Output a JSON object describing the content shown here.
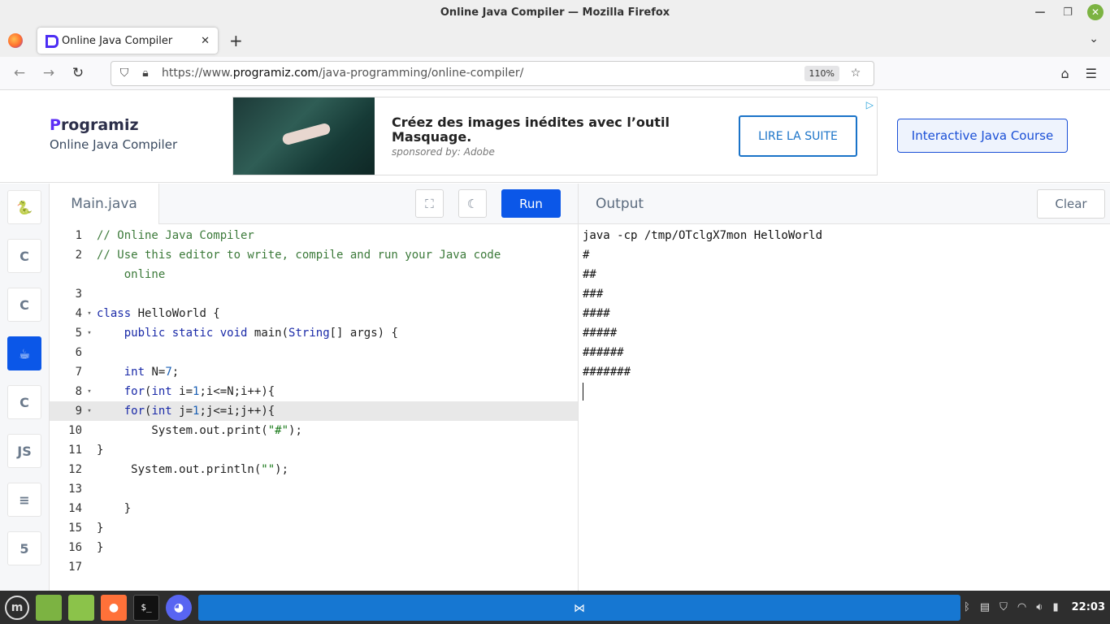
{
  "window": {
    "title": "Online Java Compiler — Mozilla Firefox"
  },
  "tab": {
    "label": "Online Java Compiler",
    "close": "✕",
    "new": "+"
  },
  "nav": {
    "url_prefix": "https://www.",
    "url_domain": "programiz.com",
    "url_path": "/java-programming/online-compiler/",
    "zoom": "110%"
  },
  "header": {
    "brand_p": "P",
    "brand_rest": "rogramiz",
    "subtitle": "Online Java Compiler",
    "course_button": "Interactive Java Course"
  },
  "ad": {
    "headline": "Créez des images inédites avec l’outil Masquage.",
    "sponsor": "sponsored by: Adobe",
    "cta": "LIRE LA SUITE"
  },
  "langbar": {
    "items": [
      {
        "name": "python",
        "glyph": "🐍"
      },
      {
        "name": "c",
        "glyph": "C"
      },
      {
        "name": "cpp",
        "glyph": "C"
      },
      {
        "name": "java",
        "glyph": "☕"
      },
      {
        "name": "csharp",
        "glyph": "C"
      },
      {
        "name": "javascript",
        "glyph": "JS"
      },
      {
        "name": "sql",
        "glyph": "≡"
      },
      {
        "name": "html",
        "glyph": "5"
      }
    ]
  },
  "editor": {
    "filename": "Main.java",
    "run_label": "Run",
    "lines": [
      {
        "n": "1",
        "fold": "",
        "text": "// Online Java Compiler"
      },
      {
        "n": "2",
        "fold": "",
        "text": "// Use this editor to write, compile and run your Java code"
      },
      {
        "n": "",
        "fold": "",
        "text": "    online"
      },
      {
        "n": "3",
        "fold": "",
        "text": ""
      },
      {
        "n": "4",
        "fold": "▾",
        "text": "class HelloWorld {"
      },
      {
        "n": "5",
        "fold": "▾",
        "text": "    public static void main(String[] args) {"
      },
      {
        "n": "6",
        "fold": "",
        "text": ""
      },
      {
        "n": "7",
        "fold": "",
        "text": "    int N=7;"
      },
      {
        "n": "8",
        "fold": "▾",
        "text": "    for(int i=1;i<=N;i++){"
      },
      {
        "n": "9",
        "fold": "▾",
        "text": "    for(int j=1;j<=i;j++){"
      },
      {
        "n": "10",
        "fold": "",
        "text": "        System.out.print(\"#\");"
      },
      {
        "n": "11",
        "fold": "",
        "text": "}"
      },
      {
        "n": "12",
        "fold": "",
        "text": "     System.out.println(\"\");"
      },
      {
        "n": "13",
        "fold": "",
        "text": ""
      },
      {
        "n": "14",
        "fold": "",
        "text": "    }"
      },
      {
        "n": "15",
        "fold": "",
        "text": "}"
      },
      {
        "n": "16",
        "fold": "",
        "text": "}"
      },
      {
        "n": "17",
        "fold": "",
        "text": ""
      }
    ]
  },
  "output": {
    "title": "Output",
    "clear_label": "Clear",
    "lines": [
      "java -cp /tmp/OTclgX7mon HelloWorld",
      "#",
      "##",
      "###",
      "####",
      "#####",
      "######",
      "#######"
    ]
  },
  "taskbar": {
    "clock": "22:03"
  }
}
